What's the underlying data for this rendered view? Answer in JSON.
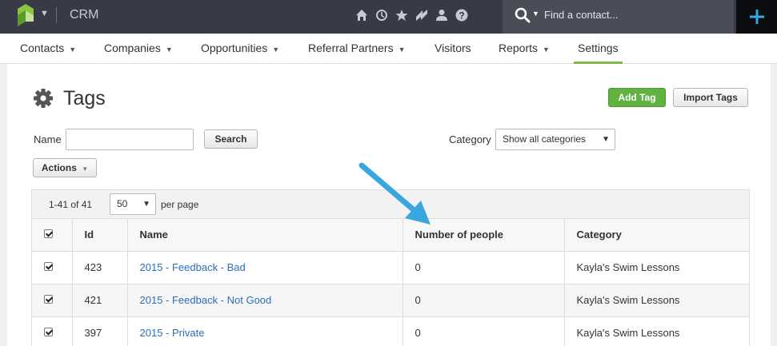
{
  "topbar": {
    "app_title": "CRM",
    "search_placeholder": "Find a contact...",
    "icons": [
      "home-icon",
      "clock-icon",
      "star-icon",
      "zap-icon",
      "person-icon",
      "help-icon"
    ]
  },
  "nav": {
    "items": [
      {
        "label": "Contacts"
      },
      {
        "label": "Companies"
      },
      {
        "label": "Opportunities"
      },
      {
        "label": "Referral Partners"
      },
      {
        "label": "Visitors"
      },
      {
        "label": "Reports"
      },
      {
        "label": "Settings"
      }
    ]
  },
  "page": {
    "title": "Tags",
    "add_tag_label": "Add Tag",
    "import_tags_label": "Import Tags",
    "name_label": "Name",
    "name_value": "",
    "search_label": "Search",
    "category_label": "Category",
    "category_selected": "Show all categories",
    "actions_label": "Actions"
  },
  "pager": {
    "range": "1-41 of 41",
    "per_page_value": "50",
    "per_page_label": "per page"
  },
  "table": {
    "headers": [
      "Id",
      "Name",
      "Number of people",
      "Category"
    ],
    "rows": [
      {
        "id": "423",
        "name": "2015 - Feedback - Bad",
        "people": "0",
        "category": "Kayla's Swim Lessons"
      },
      {
        "id": "421",
        "name": "2015 - Feedback - Not Good",
        "people": "0",
        "category": "Kayla's Swim Lessons"
      },
      {
        "id": "397",
        "name": "2015 - Private",
        "people": "0",
        "category": "Kayla's Swim Lessons"
      }
    ]
  },
  "colors": {
    "topbar": "#383b47",
    "accent_green": "#61b240",
    "link_blue": "#2a6ebb",
    "annotation_arrow": "#3aa6e0"
  }
}
